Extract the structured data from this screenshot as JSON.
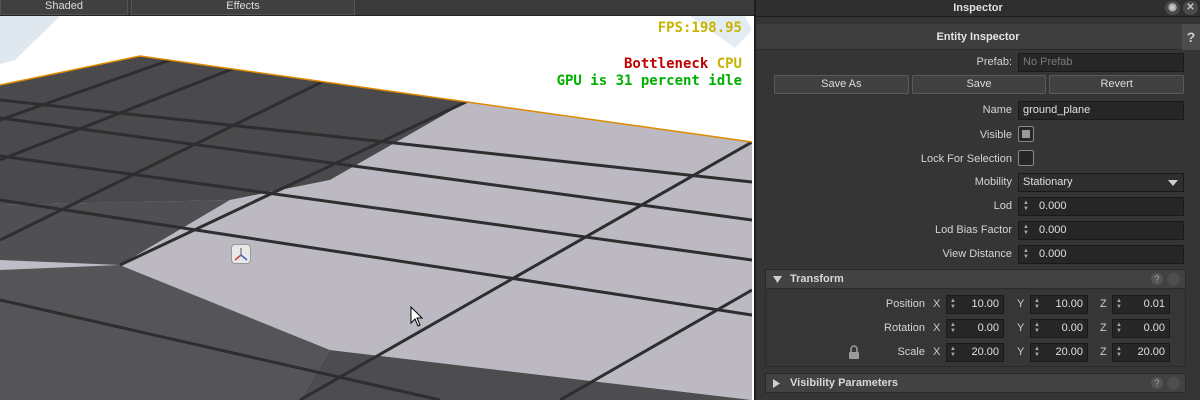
{
  "viewport": {
    "tabs": [
      "Shaded",
      "Effects"
    ],
    "hud": {
      "fps": "FPS:198.95",
      "bottleneck_label": "Bottleneck",
      "bottleneck_value": "CPU",
      "gpu_idle": "GPU is 31 percent idle"
    },
    "colors": {
      "fps": "#c8b400",
      "bottleneck": "#c00000",
      "cpu": "#c8b400",
      "gpu": "#00b000",
      "selection_outline": "#e08a00"
    }
  },
  "inspector": {
    "title": "Inspector",
    "entity_header": "Entity Inspector",
    "help_glyph": "?",
    "prefab": {
      "label": "Prefab:",
      "placeholder": "No Prefab"
    },
    "buttons": {
      "save_as": "Save As",
      "save": "Save",
      "revert": "Revert"
    },
    "name": {
      "label": "Name",
      "value": "ground_plane"
    },
    "visible": {
      "label": "Visible",
      "checked": true
    },
    "lock_for_selection": {
      "label": "Lock For Selection",
      "checked": false
    },
    "mobility": {
      "label": "Mobility",
      "value": "Stationary"
    },
    "lod": {
      "label": "Lod",
      "value": "0.000"
    },
    "lod_bias_factor": {
      "label": "Lod Bias Factor",
      "value": "0.000"
    },
    "view_distance": {
      "label": "View Distance",
      "value": "0.000"
    },
    "transform": {
      "title": "Transform",
      "axes": [
        "X",
        "Y",
        "Z"
      ],
      "position": {
        "label": "Position",
        "x": "10.00",
        "y": "10.00",
        "z": "0.01"
      },
      "rotation": {
        "label": "Rotation",
        "x": "0.00",
        "y": "0.00",
        "z": "0.00"
      },
      "scale": {
        "label": "Scale",
        "x": "20.00",
        "y": "20.00",
        "z": "20.00"
      }
    },
    "visibility_parameters": {
      "title": "Visibility Parameters"
    }
  }
}
